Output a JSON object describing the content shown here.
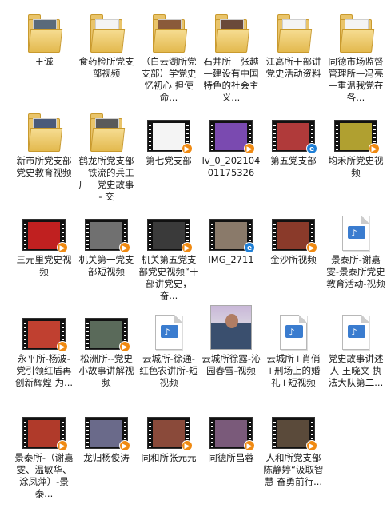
{
  "items": [
    {
      "type": "folder",
      "label": "王诚",
      "thumb": "#5a6a7a"
    },
    {
      "type": "folder",
      "label": "食药检所党支部视频",
      "thumb": "#f4f4f4"
    },
    {
      "type": "folder",
      "label": "（白云湖所党支部）学党史 忆初心 担使命...",
      "thumb": "#8a5a3a"
    },
    {
      "type": "folder",
      "label": "石井所—张越—建设有中国特色的社会主义...",
      "thumb": "#6a4a3a"
    },
    {
      "type": "folder",
      "label": "江高所干部讲党史活动资料",
      "thumb": "#f4f4f4"
    },
    {
      "type": "folder",
      "label": "同德市场监督管理所—冯亮—重温我党在各...",
      "thumb": "#f4f4f4"
    },
    {
      "type": "folder",
      "label": "新市所党支部党史教育视频",
      "thumb": "#4a5a7a"
    },
    {
      "type": "folder",
      "label": "鹤龙所党支部—铁流的兵工厂—党史故事 - 交",
      "thumb": "#5a5a5a"
    },
    {
      "type": "video",
      "label": "第七党支部",
      "frame": "#f4f4f4",
      "badge": "play"
    },
    {
      "type": "video",
      "label": "lv_0_20210401175326",
      "frame": "#7a4ab0",
      "badge": "play"
    },
    {
      "type": "video",
      "label": "第五党支部",
      "frame": "#b03a3a",
      "badge": "ie"
    },
    {
      "type": "video",
      "label": "均禾所党史视频",
      "frame": "#b0a030",
      "badge": "play"
    },
    {
      "type": "video",
      "label": "三元里党史视频",
      "frame": "#c02020",
      "badge": "play"
    },
    {
      "type": "video",
      "label": "机关第一党支部短视频",
      "frame": "#707070",
      "badge": "play"
    },
    {
      "type": "video",
      "label": "机关第五党支部党史视频“干部讲党史，奋...",
      "frame": "#3a3a3a",
      "badge": "play"
    },
    {
      "type": "video",
      "label": "IMG_2711",
      "frame": "#8a7a6a",
      "badge": "ie"
    },
    {
      "type": "video",
      "label": "金沙所视频",
      "frame": "#8a3a2a",
      "badge": "play"
    },
    {
      "type": "doc",
      "label": "景泰所-谢嘉雯-景泰所党史教育活动-视频",
      "badge": "none"
    },
    {
      "type": "video",
      "label": "永平所-杨波-党引领红盾再创新辉煌 为...",
      "frame": "#c04030",
      "badge": "play"
    },
    {
      "type": "video",
      "label": "松洲所--党史小故事讲解视频",
      "frame": "#5a6a5a",
      "badge": "play"
    },
    {
      "type": "doc",
      "label": "云城所-徐通-红色农讲所-短视频",
      "badge": "none"
    },
    {
      "type": "photo",
      "label": "云城所徐露-沁园春雪-视频",
      "badge": "none"
    },
    {
      "type": "doc",
      "label": "云城所+肖俏+刑场上的婚礼+短视频",
      "badge": "none"
    },
    {
      "type": "doc",
      "label": "党史故事讲述人 王晓文 执法大队第二...",
      "badge": "none"
    },
    {
      "type": "video",
      "label": "景泰所-（谢嘉雯、温敏华、涂凤萍）-景泰...",
      "frame": "#b03a2a",
      "badge": "play"
    },
    {
      "type": "video",
      "label": "龙归杨俊涛",
      "frame": "#6a6a8a",
      "badge": "play"
    },
    {
      "type": "video",
      "label": "同和所张元元",
      "frame": "#8a4a3a",
      "badge": "play"
    },
    {
      "type": "video",
      "label": "同德所昌蓉",
      "frame": "#7a5a7a",
      "badge": "play"
    },
    {
      "type": "video",
      "label": "人和所党支部 陈静婷“汲取智慧 奋勇前行...",
      "frame": "#5a4a3a",
      "badge": "play"
    }
  ]
}
